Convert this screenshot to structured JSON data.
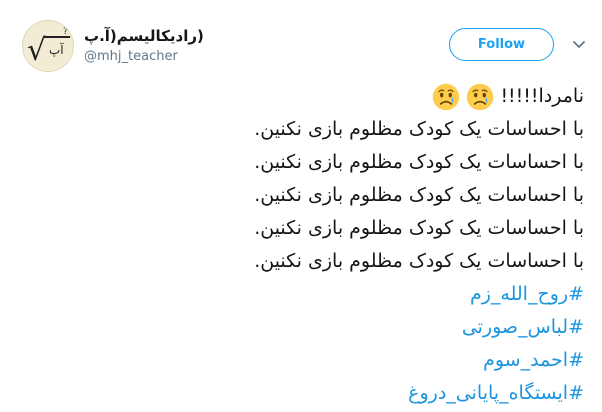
{
  "user": {
    "display_name": "(رادیکالیسم(آ.پ",
    "handle": "@mhj_teacher"
  },
  "avatar": {
    "radical_symbol": "√",
    "letters": "آپ",
    "exponent": "?"
  },
  "follow_button": {
    "label": "Follow"
  },
  "icons": {
    "avatar": "radical-sign-logo",
    "caret": "chevron-down-icon",
    "emoji": "crying-face-icon"
  },
  "tweet": {
    "first_line": "نامردا!!!!!",
    "emoji_count": 2,
    "lines": [
      "با احساسات یک کودک مظلوم بازی نکنین.",
      "با احساسات یک کودک مظلوم بازی نکنین.",
      "با احساسات یک کودک مظلوم بازی نکنین.",
      "با احساسات یک کودک مظلوم بازی نکنین.",
      "با احساسات یک کودک مظلوم بازی نکنین."
    ],
    "hashtags": [
      "#روح_الله_زم",
      "#لباس_صورتی",
      "#احمد_سوم",
      "#ایستگاه_پایانی_دروغ"
    ]
  },
  "colors": {
    "link": "#1b95e0",
    "follow_border": "#1da1f2",
    "handle": "#657786",
    "text": "#14171a"
  }
}
